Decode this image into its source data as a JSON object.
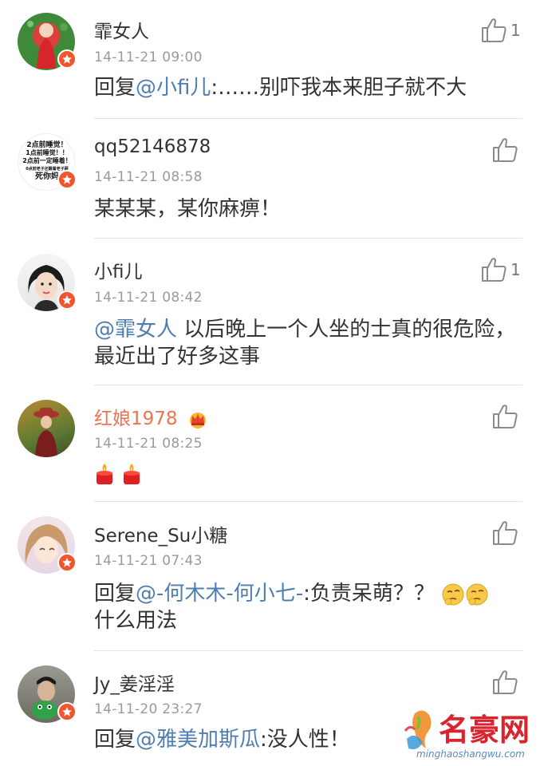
{
  "comments": [
    {
      "user": "霏女人",
      "time": "14-11-21 09:00",
      "prefix": "回复",
      "mention": "@小fi儿",
      "text": ":……别吓我本来胆子就不大",
      "likes": "1"
    },
    {
      "user": "qq52146878",
      "time": "14-11-21 08:58",
      "text": "某某某，某你麻痹！",
      "likes": "",
      "avatar_lines": [
        "2点前睡觉！",
        "1点前睡觉！！",
        "2点前一定睡着！",
        "0点前老子还醒着老子砸",
        "死你妈"
      ]
    },
    {
      "user": "小fi儿",
      "time": "14-11-21 08:42",
      "mention": "@霏女人",
      "text": " 以后晚上一个人坐的士真的很危险，最近出了好多这事",
      "likes": "1"
    },
    {
      "user": "红娘1978",
      "time": "14-11-21 08:25",
      "likes": "",
      "emojis": [
        "candle-emoji",
        "candle-emoji"
      ]
    },
    {
      "user": "Serene_Su小糖",
      "time": "14-11-21 07:43",
      "prefix": "回复",
      "mention": "@-何木木-何小七-",
      "text": ":负责呆萌？？",
      "text2": "什么用法",
      "likes": ""
    },
    {
      "user": "Jy_姜淫淫",
      "time": "14-11-20 23:27",
      "prefix": "回复",
      "mention": "@雅美加斯瓜",
      "text": ":没人性！",
      "likes": ""
    }
  ],
  "watermark": {
    "brand": "名豪网",
    "url": "minghaoshangwu.com"
  },
  "colors": {
    "mention": "#507daf",
    "vip_name": "#eb7350",
    "badge": "#f2542d",
    "time": "#9a9a9a"
  }
}
